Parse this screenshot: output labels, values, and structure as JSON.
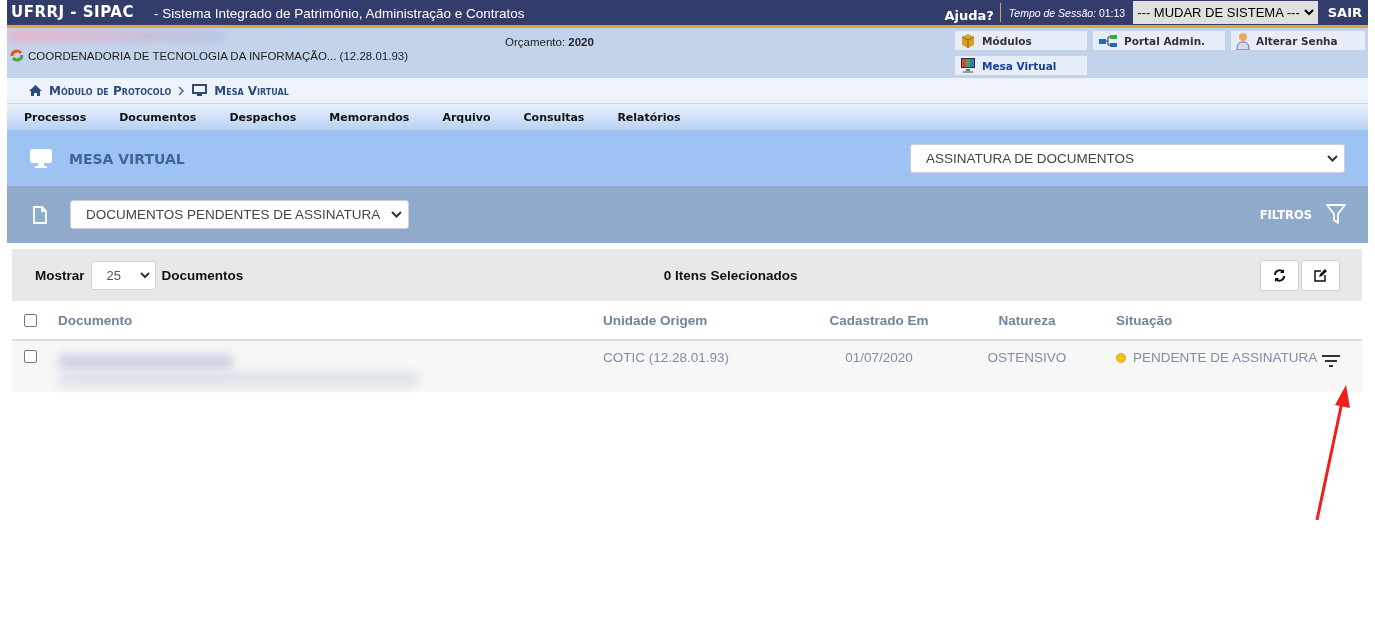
{
  "top_bar": {
    "system": "UFRRJ - SIPAC",
    "subtitle": "- Sistema Integrado de Patrimônio, Administração e Contratos",
    "help": "Ajuda?",
    "session_label": "Tempo de Sessão:",
    "session_time": "01:13",
    "system_select": "--- MUDAR DE SISTEMA ---",
    "logout": "SAIR"
  },
  "info": {
    "unit": "COORDENADORIA DE TECNOLOGIA DA INFORMAÇÃO... (12.28.01.93)",
    "budget_label": "Orçamento:",
    "budget_year": "2020",
    "shortcuts": [
      {
        "label": "Módulos",
        "selected": false
      },
      {
        "label": "Portal Admin.",
        "selected": false
      },
      {
        "label": "Alterar Senha",
        "selected": false
      },
      {
        "label": "Mesa Virtual",
        "selected": true
      }
    ]
  },
  "breadcrumb": [
    "Módulo de Protocolo",
    "Mesa Virtual"
  ],
  "menu": [
    "Processos",
    "Documentos",
    "Despachos",
    "Memorandos",
    "Arquivo",
    "Consultas",
    "Relatórios"
  ],
  "panel": {
    "title": "MESA VIRTUAL",
    "mode_select": "ASSINATURA DE DOCUMENTOS",
    "list_select": "DOCUMENTOS PENDENTES DE ASSINATURA",
    "filters": "FILTROS"
  },
  "table": {
    "show_label": "Mostrar",
    "page_size": "25",
    "show_suffix": "Documentos",
    "selected_count": "0 Itens Selecionados",
    "header_checked": false,
    "columns": [
      "Documento",
      "Unidade Origem",
      "Cadastrado Em",
      "Natureza",
      "Situação"
    ],
    "rows": [
      {
        "checked": false,
        "unit": "COTIC (12.28.01.93)",
        "date": "01/07/2020",
        "nature": "OSTENSIVO",
        "status": "PENDENTE DE ASSINATURA",
        "color": "#f0c419"
      }
    ]
  }
}
